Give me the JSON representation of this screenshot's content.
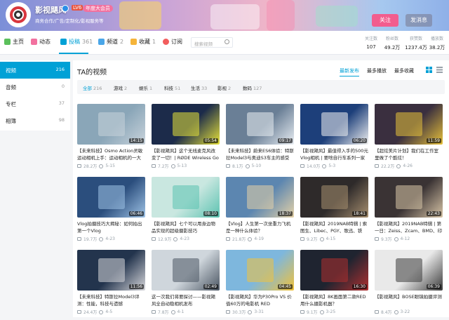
{
  "header": {
    "username": "影视飓风",
    "level": "LV6",
    "vip": "年度大会员",
    "bio": "商务合作/广告/定制化/影视服务等",
    "follow_label": "关注",
    "message_label": "发消息"
  },
  "nav": {
    "items": [
      {
        "label": "主页",
        "count": ""
      },
      {
        "label": "动态",
        "count": ""
      },
      {
        "label": "投稿",
        "count": "361"
      },
      {
        "label": "频道",
        "count": "2"
      },
      {
        "label": "收藏",
        "count": "1"
      },
      {
        "label": "订阅",
        "count": ""
      }
    ],
    "search_placeholder": "搜索视频",
    "stats": [
      {
        "label": "关注数",
        "value": "107"
      },
      {
        "label": "粉丝数",
        "value": "49.2万"
      },
      {
        "label": "获赞数",
        "value": "1237.4万"
      },
      {
        "label": "播放数",
        "value": "38.2万"
      }
    ]
  },
  "sidebar": {
    "items": [
      {
        "label": "视频",
        "count": "216"
      },
      {
        "label": "音频",
        "count": "0"
      },
      {
        "label": "专栏",
        "count": "37"
      },
      {
        "label": "相簿",
        "count": "98"
      }
    ]
  },
  "main": {
    "title": "TA的视频",
    "sort": [
      "最新发布",
      "最多播放",
      "最多收藏"
    ],
    "filters": [
      {
        "label": "全部",
        "count": "216"
      },
      {
        "label": "游戏",
        "count": "2"
      },
      {
        "label": "娱乐",
        "count": "1"
      },
      {
        "label": "科技",
        "count": "51"
      },
      {
        "label": "生活",
        "count": "33"
      },
      {
        "label": "影视",
        "count": "2"
      },
      {
        "label": "数码",
        "count": "127"
      }
    ],
    "videos": [
      {
        "title": "【未来科技】Osmo Action灵敏运动相机上手：运动相机的一大步",
        "views": "28.2万",
        "date": "5-15",
        "duration": "14:15",
        "colors": [
          "#8aa6b8",
          "#c9d3db"
        ]
      },
      {
        "title": "【影视飓风】这个无线麦克风改变了一切！| RØDE Wireless Go",
        "views": "7.2万",
        "date": "5-13",
        "duration": "05:54",
        "colors": [
          "#1c2b4a",
          "#e8e33a"
        ]
      },
      {
        "title": "【未来科技】蔚来ES6体验：特斯拉Model3与奥迪S3车主的感受",
        "views": "8.1万",
        "date": "5-10",
        "duration": "09:17",
        "colors": [
          "#6a7f96",
          "#e9eef3"
        ]
      },
      {
        "title": "【影视飓风】最值得入手的500元Vlog相机 | 要啥自行车系列一家尼",
        "views": "14.0万",
        "date": "5-3",
        "duration": "06:20",
        "colors": [
          "#1d3f7a",
          "#f2f2f2"
        ]
      },
      {
        "title": "【超炫美片计划】我们在工作室里做了个酷炫！",
        "views": "22.2万",
        "date": "4-26",
        "duration": "11:59",
        "colors": [
          "#3a2f3f",
          "#e8c23a"
        ]
      },
      {
        "title": "Vlog拍摄技巧大揭秘：如何拍出第一个Vlog",
        "views": "19.7万",
        "date": "4-23",
        "duration": "06:46",
        "colors": [
          "#2b4e7d",
          "#9fc3e6"
        ]
      },
      {
        "title": "【影视飓风】七个可以用身边物品实现的超级摄影技巧",
        "views": "12.9万",
        "date": "4-23",
        "duration": "08:10",
        "colors": [
          "#c9e7e0",
          "#5ac2b0"
        ]
      },
      {
        "title": "【Vlog】人生第一次坐重力飞机是一种什么体验？",
        "views": "21.8万",
        "date": "4-19",
        "duration": "18:37",
        "colors": [
          "#5c86b0",
          "#e6d2a8"
        ]
      },
      {
        "title": "【影视飓风】2019NAB特辑 | 索图生、Libec、PGY、歌迅、铁头、罗",
        "views": "9.2万",
        "date": "4-15",
        "duration": "18:41",
        "colors": [
          "#2e2a2a",
          "#a89070"
        ]
      },
      {
        "title": "【影视飓风】2019NAB特辑 | 第一日：Zeiss、Zcam、BMD、印造",
        "views": "9.3万",
        "date": "4-12",
        "duration": "22:43",
        "colors": [
          "#3a3334",
          "#d9c6a8"
        ]
      },
      {
        "title": "【未来科技】特斯拉Model3评测：性能，科技与遗憾",
        "views": "24.4万",
        "date": "4-5",
        "duration": "11:56",
        "colors": [
          "#23344d",
          "#d8d8dc"
        ]
      },
      {
        "title": "这一次我们将要探讨——影视飓风全自动稳相机发布",
        "views": "7.8万",
        "date": "4-1",
        "duration": "02:49",
        "colors": [
          "#cfd6dc",
          "#4a5562"
        ]
      },
      {
        "title": "【影视飓风】华为P30Pro VS 价值60万的电影机 RED MONSTRO 8K",
        "views": "30.3万",
        "date": "3-31",
        "duration": "04:45",
        "colors": [
          "#7eb7dd",
          "#f2c23a"
        ]
      },
      {
        "title": "【影视飓风】8K画面第二款RED用什么摄影机器？",
        "views": "9.1万",
        "date": "3-25",
        "duration": "16:30",
        "colors": [
          "#1f2430",
          "#b03030"
        ]
      },
      {
        "title": "【影视飓风】BOSE眼镜拍摄评测",
        "views": "8.4万",
        "date": "3-22",
        "duration": "06:39",
        "colors": [
          "#e9e9e9",
          "#3a3a3a"
        ]
      }
    ]
  }
}
